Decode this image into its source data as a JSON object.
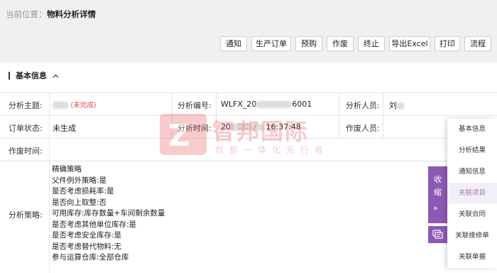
{
  "breadcrumb": {
    "label": "当前位置：",
    "title": "物料分析详情"
  },
  "toolbar": {
    "buttons": [
      "通知",
      "生产订单",
      "预购",
      "作废",
      "终止",
      "导出Excel",
      "打印",
      "流程"
    ]
  },
  "section": {
    "title": "基本信息"
  },
  "fields": {
    "subject_label": "分析主题:",
    "subject_status": "(未完成)",
    "code_label": "分析编号:",
    "code_prefix": "WLFX_20",
    "code_suffix": "6001",
    "analyst_label": "分析人员:",
    "analyst_value": "刘",
    "order_status_label": "订单状态:",
    "order_status_value": "未生成",
    "time_label": "分析时间:",
    "time_prefix": "20",
    "time_suffix": "16:37:48",
    "void_person_label": "作废人员:",
    "void_time_label": "作废时间:",
    "strategy_label": "分析策略:"
  },
  "strategy_lines": [
    "精确策略",
    "父件例外策略:是",
    "是否考虑损耗率:是",
    "是否向上取整:否",
    "可用库存:库存数量+车间剩余数量",
    "是否考虑其他单位库存:是",
    "是否考虑安全库存:是",
    "是否考虑替代物料:无",
    "参与运算仓库:全部仓库"
  ],
  "watermark": {
    "brand": "智邦国际",
    "slogan": "数智一体化先行者"
  },
  "collapse": {
    "label": "收缩",
    "arrow": "»"
  },
  "sidenav": {
    "items": [
      "基本信息",
      "分析结果",
      "通知信息",
      "关联项目",
      "关联合同",
      "关联维修单",
      "关联单据"
    ],
    "active_index": 3
  },
  "colors": {
    "accent": "#8e59b3",
    "danger": "#e04545",
    "brand": "#e8474b"
  }
}
